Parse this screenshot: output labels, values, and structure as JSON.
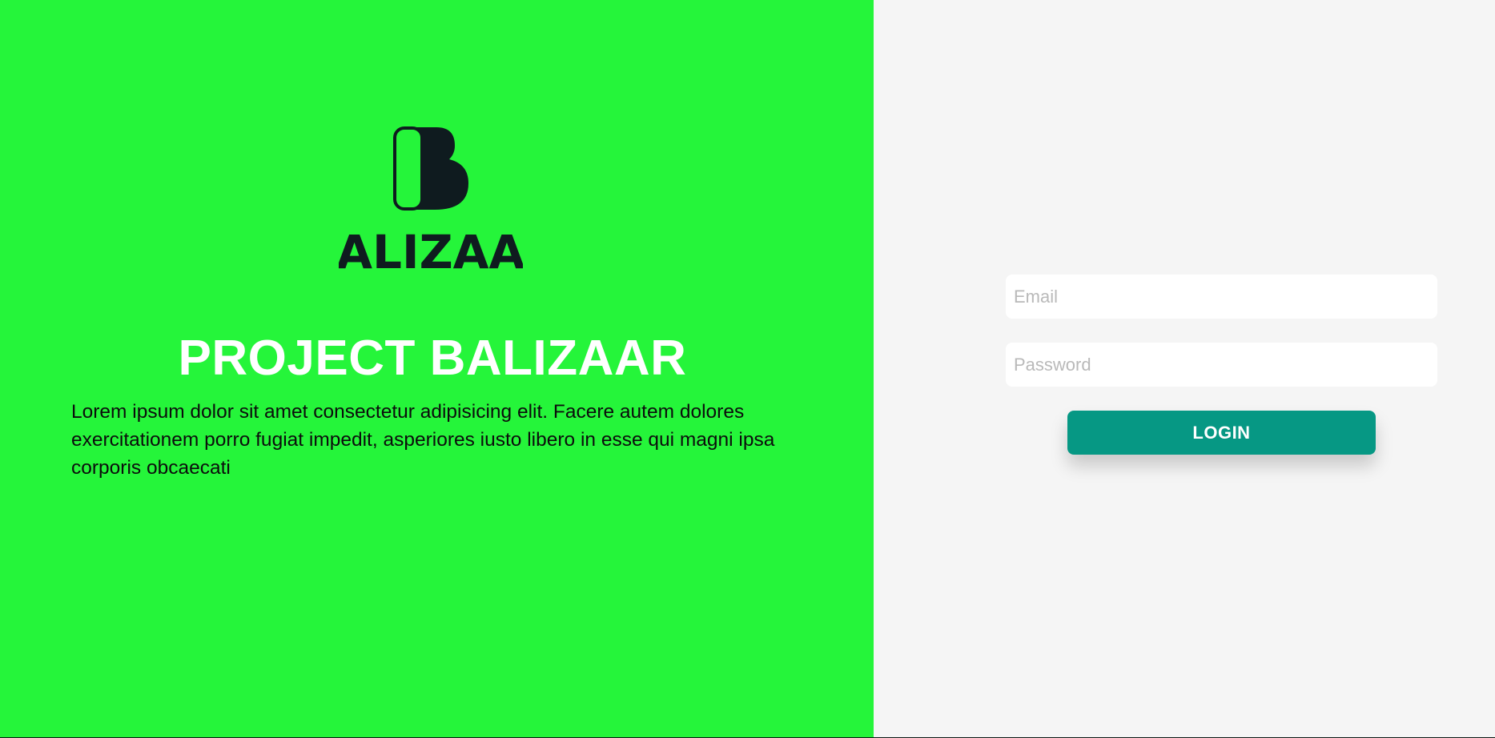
{
  "brand": {
    "logo_wordmark": "BALIZAAR",
    "logo_icon": "b-monogram-icon",
    "title": "PROJECT BALIZAAR",
    "description": "Lorem ipsum dolor sit amet consectetur adipisicing elit. Facere autem dolores exercitationem porro fugiat impedit, asperiores iusto libero in esse qui magni ipsa corporis obcaecati"
  },
  "login": {
    "email_placeholder": "Email",
    "email_value": "",
    "password_placeholder": "Password",
    "password_value": "",
    "button_label": "LOGIN"
  },
  "colors": {
    "hero_background": "#25f53a",
    "panel_background": "#f5f5f5",
    "logo_color": "#0f1b1f",
    "button_background": "#069884",
    "button_text": "#ffffff"
  }
}
